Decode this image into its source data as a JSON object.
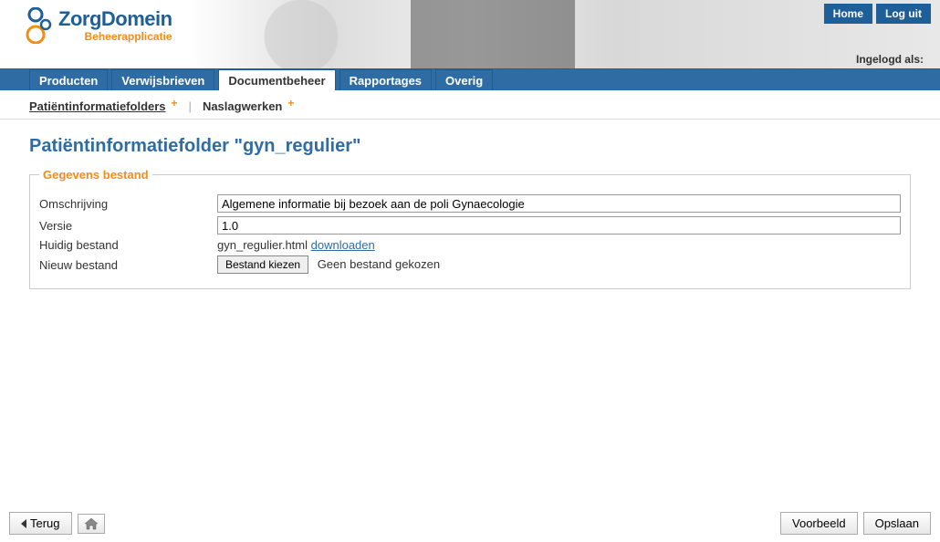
{
  "header": {
    "home": "Home",
    "logout": "Log uit",
    "logged_in_as": "Ingelogd als:",
    "logo_main": "ZorgDomein",
    "logo_sub": "Beheerapplicatie"
  },
  "mainnav": {
    "tabs": [
      {
        "label": "Producten",
        "active": false
      },
      {
        "label": "Verwijsbrieven",
        "active": false
      },
      {
        "label": "Documentbeheer",
        "active": true
      },
      {
        "label": "Rapportages",
        "active": false
      },
      {
        "label": "Overig",
        "active": false
      }
    ]
  },
  "subnav": {
    "item1": "Patiëntinformatiefolders",
    "item2": "Naslagwerken"
  },
  "page": {
    "title": "Patiëntinformatiefolder \"gyn_regulier\""
  },
  "fieldset": {
    "legend": "Gegevens bestand",
    "omschrijving_label": "Omschrijving",
    "omschrijving_value": "Algemene informatie bij bezoek aan de poli Gynaecologie",
    "versie_label": "Versie",
    "versie_value": "1.0",
    "huidig_label": "Huidig bestand",
    "huidig_file": "gyn_regulier.html",
    "huidig_link": "downloaden",
    "nieuw_label": "Nieuw bestand",
    "file_button": "Bestand kiezen",
    "file_status": "Geen bestand gekozen"
  },
  "footer": {
    "back": "Terug",
    "preview": "Voorbeeld",
    "save": "Opslaan"
  }
}
